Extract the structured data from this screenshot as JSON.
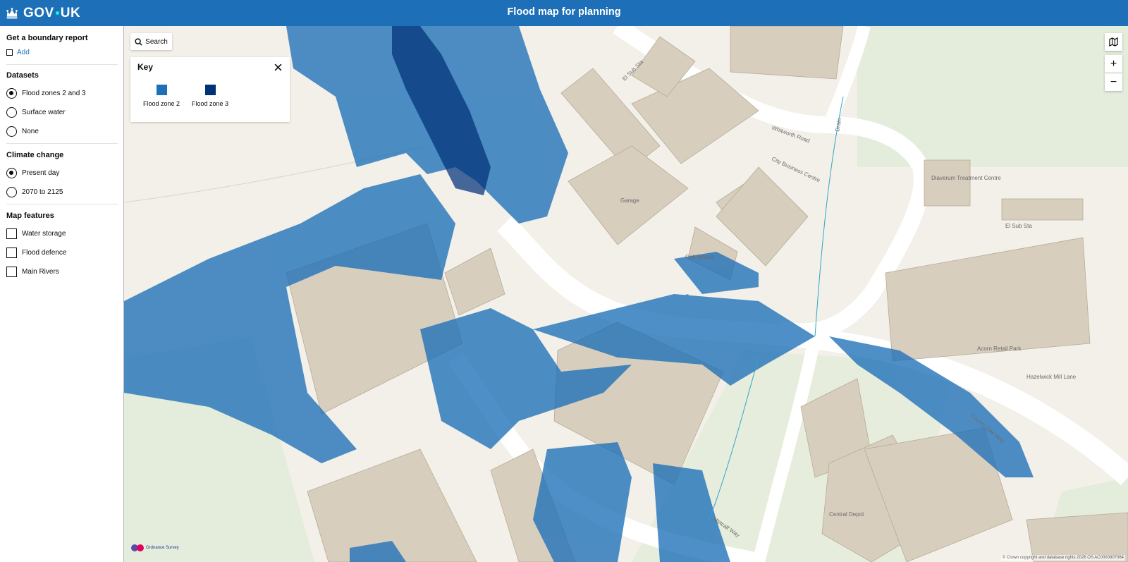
{
  "header": {
    "brand_left": "GOV",
    "brand_right": "UK",
    "title": "Flood map for planning"
  },
  "sidebar": {
    "boundary": {
      "title": "Get a boundary report",
      "add_label": "Add"
    },
    "datasets": {
      "title": "Datasets",
      "options": [
        {
          "label": "Flood zones 2 and 3",
          "checked": true
        },
        {
          "label": "Surface water",
          "checked": false
        },
        {
          "label": "None",
          "checked": false
        }
      ]
    },
    "climate": {
      "title": "Climate change",
      "options": [
        {
          "label": "Present day",
          "checked": true
        },
        {
          "label": "2070 to 2125",
          "checked": false
        }
      ]
    },
    "features": {
      "title": "Map features",
      "options": [
        {
          "label": "Water storage",
          "checked": false
        },
        {
          "label": "Flood defence",
          "checked": false
        },
        {
          "label": "Main Rivers",
          "checked": false
        }
      ]
    }
  },
  "map": {
    "search_label": "Search",
    "key": {
      "title": "Key",
      "items": [
        {
          "label": "Flood zone 2",
          "color": "#1d70b8"
        },
        {
          "label": "Flood zone 3",
          "color": "#003078"
        }
      ]
    },
    "controls": {
      "zoom_in": "+",
      "zoom_out": "−"
    },
    "labels": {
      "el_sub_sta_top": "El Sub Sta",
      "whitworth_road": "Whitworth Road",
      "city_business_centre": "City Business Centre",
      "garage": "Garage",
      "oak_house": "Oak House",
      "diaverum": "Diaverum Treatment Centre",
      "el_sub_sta_right": "El Sub Sta",
      "acorn_retail_park": "Acorn Retail Park",
      "hazelwick_mill_lane": "Hazelwick Mill Lane",
      "county_oak_way": "County Oak Way",
      "central_depot": "Central Depot",
      "metcalf_way": "Metcalf Way",
      "drain": "Drain"
    },
    "os_label": "Ordnance Survey",
    "copyright": "© Crown copyright and database rights 2026 OS AC0000807064"
  }
}
